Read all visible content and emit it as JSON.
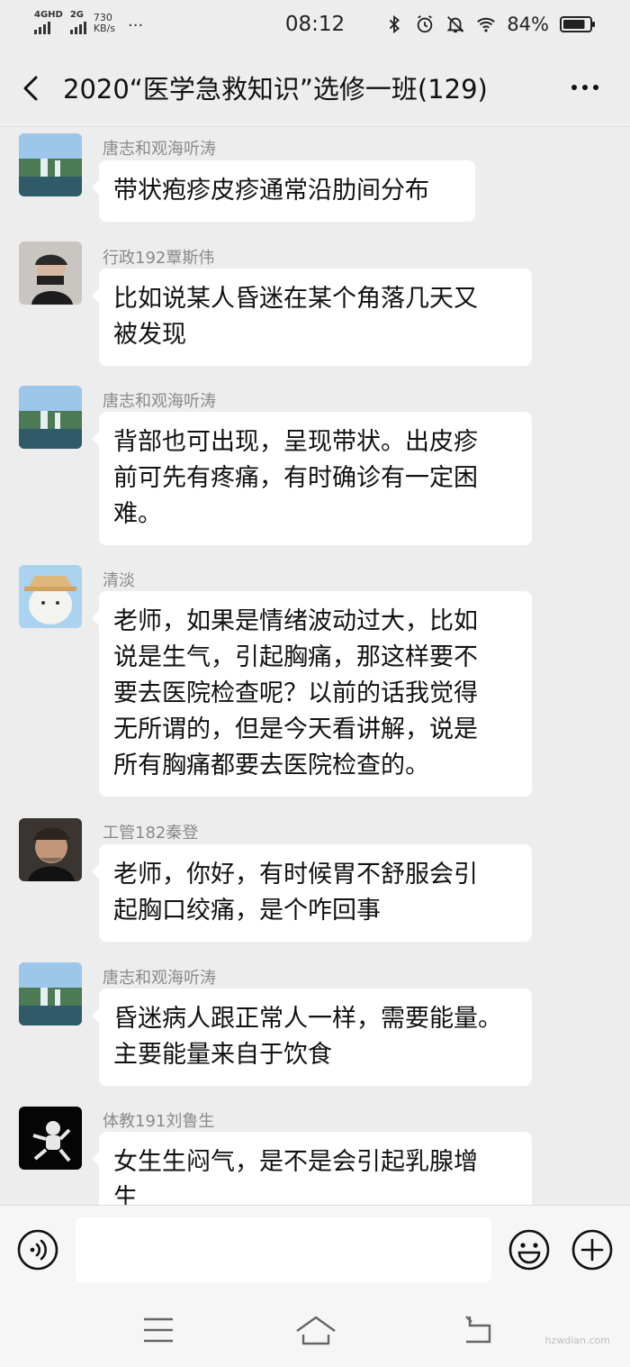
{
  "status_bar": {
    "network1": "4GHD",
    "network2": "2G",
    "speed_value": "730",
    "speed_unit": "KB/s",
    "more": "···",
    "time": "08:12",
    "battery_percent": "84%",
    "battery_level": 0.84,
    "icons": [
      "bluetooth-icon",
      "alarm-icon",
      "mute-bell-icon",
      "wifi-icon",
      "battery-icon"
    ]
  },
  "header": {
    "title": "2020“医学急救知识”选修一班(129)"
  },
  "messages": [
    {
      "sender": "唐志和观海听涛",
      "avatar": "landscape-waterfall",
      "lines": [
        "带状疱疹皮疹通常沿肋间分布"
      ]
    },
    {
      "sender": "行政192覃斯伟",
      "avatar": "person-photo",
      "lines": [
        "比如说某人昏迷在某个角落几天又",
        "被发现"
      ]
    },
    {
      "sender": "唐志和观海听涛",
      "avatar": "landscape-waterfall",
      "lines": [
        "背部也可出现，呈现带状。出皮疹",
        "前可先有疼痛，有时确诊有一定困",
        "难。"
      ]
    },
    {
      "sender": "清淡",
      "avatar": "cartoon-bear",
      "lines": [
        "老师，如果是情绪波动过大，比如",
        "说是生气，引起胸痛，那这样要不",
        "要去医院检查呢？以前的话我觉得",
        "无所谓的，但是今天看讲解，说是",
        "所有胸痛都要去医院检查的。"
      ]
    },
    {
      "sender": "工管182秦登",
      "avatar": "man-portrait",
      "lines": [
        "老师，你好，有时候胃不舒服会引",
        "起胸口绞痛，是个咋回事"
      ]
    },
    {
      "sender": "唐志和观海听涛",
      "avatar": "landscape-waterfall",
      "lines": [
        "昏迷病人跟正常人一样，需要能量。",
        "主要能量来自于饮食"
      ]
    },
    {
      "sender": "体教191刘鲁生",
      "avatar": "astronaut",
      "lines": [
        "女生生闷气，是不是会引起乳腺增",
        "生"
      ]
    }
  ],
  "watermark": "hzwdian.com",
  "colors": {
    "background": "#ededed",
    "bubble": "#ffffff",
    "sender": "#8a8a8a"
  }
}
